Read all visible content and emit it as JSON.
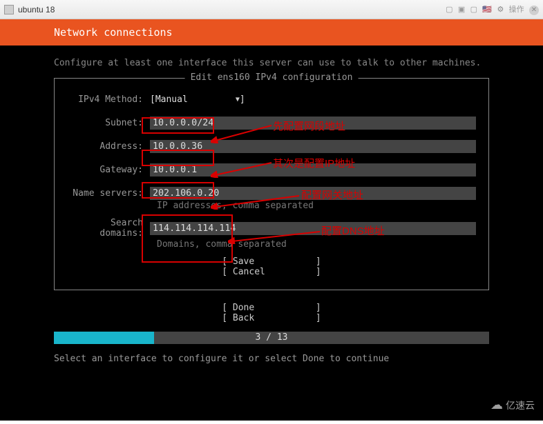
{
  "vm": {
    "title": "ubuntu 18",
    "action_text": "操作"
  },
  "header": {
    "title": "Network connections"
  },
  "subtitle": "Configure at least one interface this server can use to talk to other machines.",
  "box": {
    "title": "Edit ens160 IPv4 configuration",
    "method_label": "IPv4 Method:",
    "method_value": "Manual",
    "rows": {
      "subnet": {
        "label": "Subnet:",
        "value": "10.0.0.0/24"
      },
      "address": {
        "label": "Address:",
        "value": "10.0.0.36"
      },
      "gateway": {
        "label": "Gateway:",
        "value": "10.0.0.1"
      },
      "dns": {
        "label": "Name servers:",
        "value": "202.106.0.20",
        "hint": "IP addresses, comma separated"
      },
      "search": {
        "label": "Search domains:",
        "value": "114.114.114.114",
        "hint": "Domains, comma separated"
      }
    },
    "save": "Save",
    "cancel": "Cancel"
  },
  "footer": {
    "done": "Done",
    "back": "Back"
  },
  "progress": {
    "current": 3,
    "total": 13,
    "text": "3 / 13"
  },
  "bottom": "Select an interface to configure it or select Done to continue",
  "annotations": {
    "a1": "先配置网段地址",
    "a2": "其次是配置IP地址",
    "a3": "配置网关地址",
    "a4": "配置DNS地址"
  },
  "watermark": "亿速云"
}
